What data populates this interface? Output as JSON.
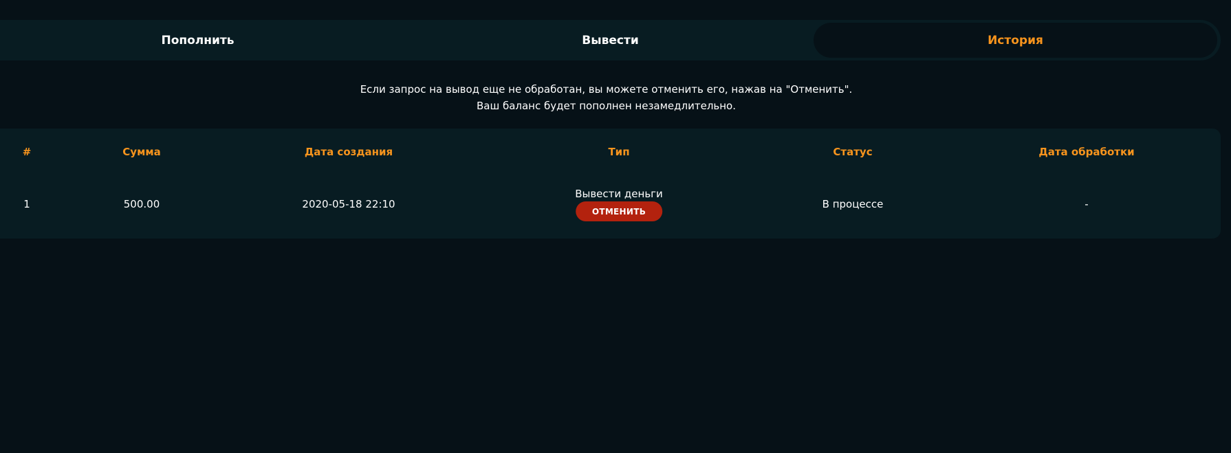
{
  "tabs": {
    "deposit": "Пополнить",
    "withdraw": "Вывести",
    "history": "История"
  },
  "info": {
    "line1": "Если запрос на вывод еще не обработан, вы можете отменить его, нажав на \"Отменить\".",
    "line2": "Ваш баланс будет пополнен незамедлительно."
  },
  "table": {
    "headers": [
      "#",
      "Сумма",
      "Дата создания",
      "Тип",
      "Статус",
      "Дата обработки"
    ],
    "rows": [
      {
        "num": "1",
        "amount": "500.00",
        "created": "2020-05-18 22:10",
        "type": "Вывести деньги",
        "cancel_label": "ОТМЕНИТЬ",
        "status": "В процессе",
        "processed": "-"
      }
    ]
  },
  "colors": {
    "background": "#061117",
    "panel": "#081c22",
    "accent": "#f7941d",
    "cancel": "#b3220e"
  }
}
